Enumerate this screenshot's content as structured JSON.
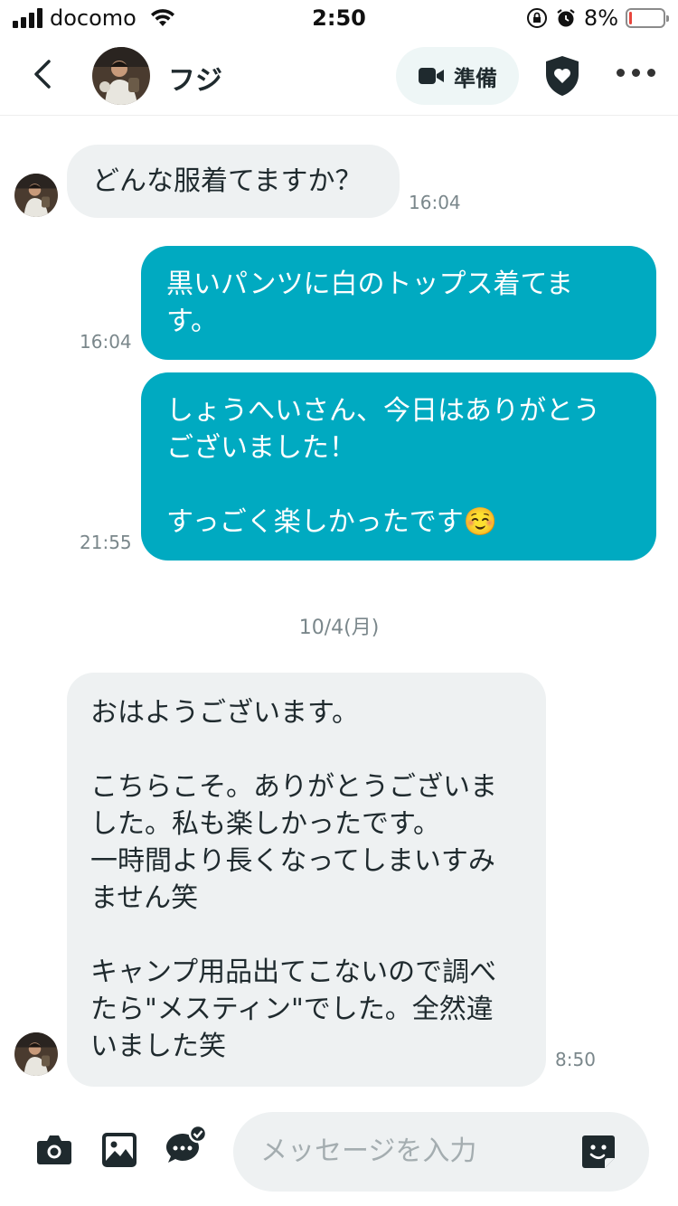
{
  "status_bar": {
    "carrier": "docomo",
    "time": "2:50",
    "battery_percent_label": "8%",
    "battery_level": 0.08,
    "icons": [
      "signal-icon",
      "wifi-icon",
      "rotation-lock-icon",
      "alarm-icon",
      "battery-icon"
    ]
  },
  "header": {
    "back_icon": "chevron-left-icon",
    "contact_name": "フジ",
    "video_button_label": "準備",
    "video_icon": "video-camera-icon",
    "safety_icon": "shield-heart-icon",
    "more_icon": "more-horizontal-icon"
  },
  "messages": [
    {
      "direction": "incoming",
      "text": "どんな服着てますか？",
      "time": "16:04"
    },
    {
      "direction": "outgoing",
      "text": "黒いパンツに白のトップス着てま\nす。",
      "time": "16:04"
    },
    {
      "direction": "outgoing",
      "text": "しょうへいさん、今日はありがとう\nございました！\n\nすっごく楽しかったです☺️",
      "time": "21:55"
    },
    {
      "direction": "incoming",
      "text": "おはようございます。\n\nこちらこそ。ありがとうございま\nした。私も楽しかったです。\n一時間より長くなってしまいすみ\nません笑\n\nキャンプ用品出てこないので調べ\nたら\"メスティン\"でした。全然違\nいました笑",
      "time": "8:50"
    }
  ],
  "date_separator": "10/4(月)",
  "input_bar": {
    "placeholder": "メッセージを入力",
    "icons": [
      "camera-icon",
      "image-icon",
      "chat-check-icon",
      "sticker-icon"
    ]
  },
  "colors": {
    "outgoing_bubble": "#00aac1",
    "incoming_bubble": "#eef1f2",
    "text_dark": "#1f2a2e",
    "timestamp": "#7a878b",
    "battery_low": "#e8453c"
  }
}
